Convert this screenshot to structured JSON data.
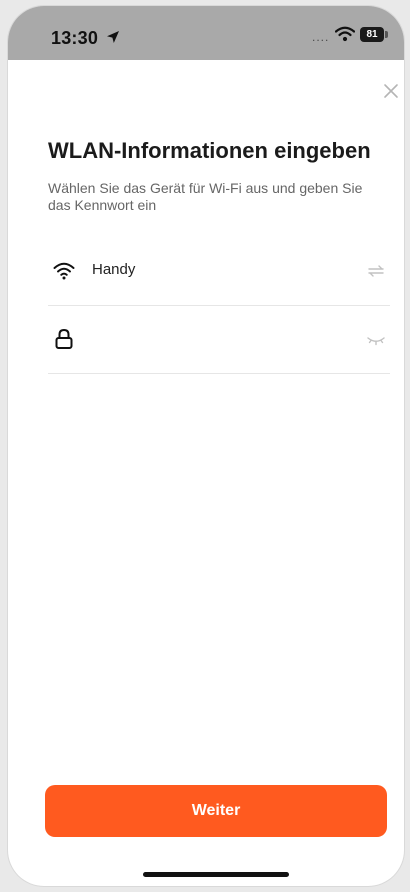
{
  "status_bar": {
    "time": "13:30",
    "signal_dots": "....",
    "battery_level": "81",
    "location_icon": "location-arrow-icon",
    "wifi_icon": "wifi-icon"
  },
  "header": {
    "close_icon": "close-icon"
  },
  "main": {
    "title": "WLAN-Informationen eingeben",
    "subtitle": "Wählen Sie das Gerät für Wi-Fi aus und geben Sie das Kennwort ein",
    "wifi_row": {
      "icon": "wifi-icon",
      "ssid": "Handy",
      "action_icon": "switch-network-icon"
    },
    "password_row": {
      "icon": "lock-icon",
      "value": "",
      "placeholder": "",
      "action_icon": "hide-password-eye-icon"
    }
  },
  "footer": {
    "next_label": "Weiter"
  },
  "colors": {
    "accent": "#ff5a1f",
    "status_bar_bg": "#a9a9a9",
    "title_text": "#1b1b1b",
    "secondary_text": "#666666"
  }
}
